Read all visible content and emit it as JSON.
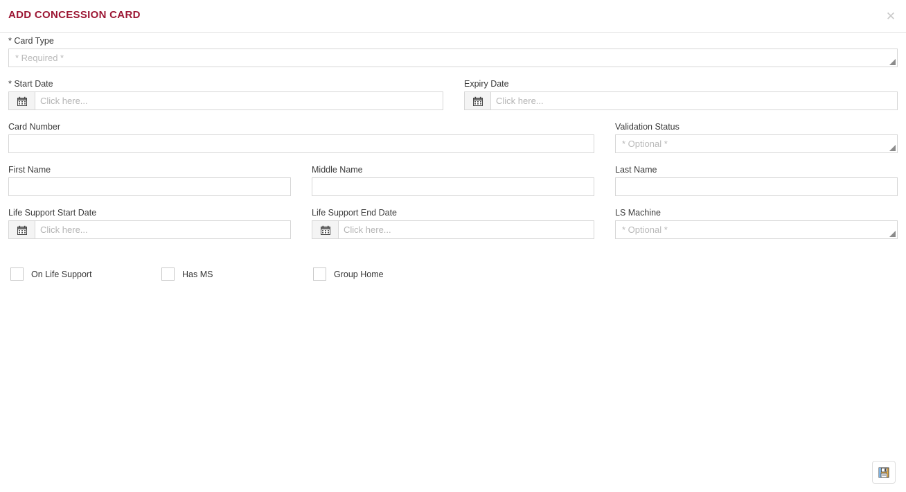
{
  "header": {
    "title": "ADD CONCESSION CARD",
    "close_icon": "close-icon"
  },
  "form": {
    "fields": [
      {
        "key": "card_type",
        "label": "* Card Type",
        "type": "dropdown",
        "value": "",
        "placeholder": "* Required *",
        "required": true
      },
      {
        "key": "start_date",
        "label": "* Start Date",
        "type": "date",
        "value": "",
        "placeholder": "Click here...",
        "icon": "calendar-icon",
        "required": true
      },
      {
        "key": "expiry_date",
        "label": "Expiry Date",
        "type": "date",
        "value": "",
        "placeholder": "Click here...",
        "icon": "calendar-icon",
        "required": false
      },
      {
        "key": "card_number",
        "label": "Card Number",
        "type": "text",
        "value": "",
        "placeholder": "",
        "required": false
      },
      {
        "key": "validation_status",
        "label": "Validation Status",
        "type": "dropdown",
        "value": "",
        "placeholder": "* Optional *",
        "required": false
      },
      {
        "key": "first_name",
        "label": "First Name",
        "type": "text",
        "value": "",
        "placeholder": "",
        "required": false
      },
      {
        "key": "middle_name",
        "label": "Middle Name",
        "type": "text",
        "value": "",
        "placeholder": "",
        "required": false
      },
      {
        "key": "last_name",
        "label": "Last Name",
        "type": "text",
        "value": "",
        "placeholder": "",
        "required": false
      },
      {
        "key": "life_support_start_date",
        "label": "Life Support Start Date",
        "type": "date",
        "value": "",
        "placeholder": "Click here...",
        "icon": "calendar-icon",
        "required": false
      },
      {
        "key": "life_support_end_date",
        "label": "Life Support End Date",
        "type": "date",
        "value": "",
        "placeholder": "Click here...",
        "icon": "calendar-icon",
        "required": false
      },
      {
        "key": "ls_machine",
        "label": "LS Machine",
        "type": "dropdown",
        "value": "",
        "placeholder": "* Optional *",
        "required": false
      }
    ],
    "checkboxes": [
      {
        "key": "on_life_support",
        "label": "On Life Support",
        "checked": false
      },
      {
        "key": "has_ms",
        "label": "Has MS",
        "checked": false
      },
      {
        "key": "group_home",
        "label": "Group Home",
        "checked": false
      }
    ]
  },
  "actions": {
    "save_icon": "save-icon",
    "save_title": "Save"
  },
  "colors": {
    "title": "#9c1734",
    "border": "#d6d6d6",
    "placeholder": "#b4b4b4",
    "label": "#3a3a3a"
  }
}
